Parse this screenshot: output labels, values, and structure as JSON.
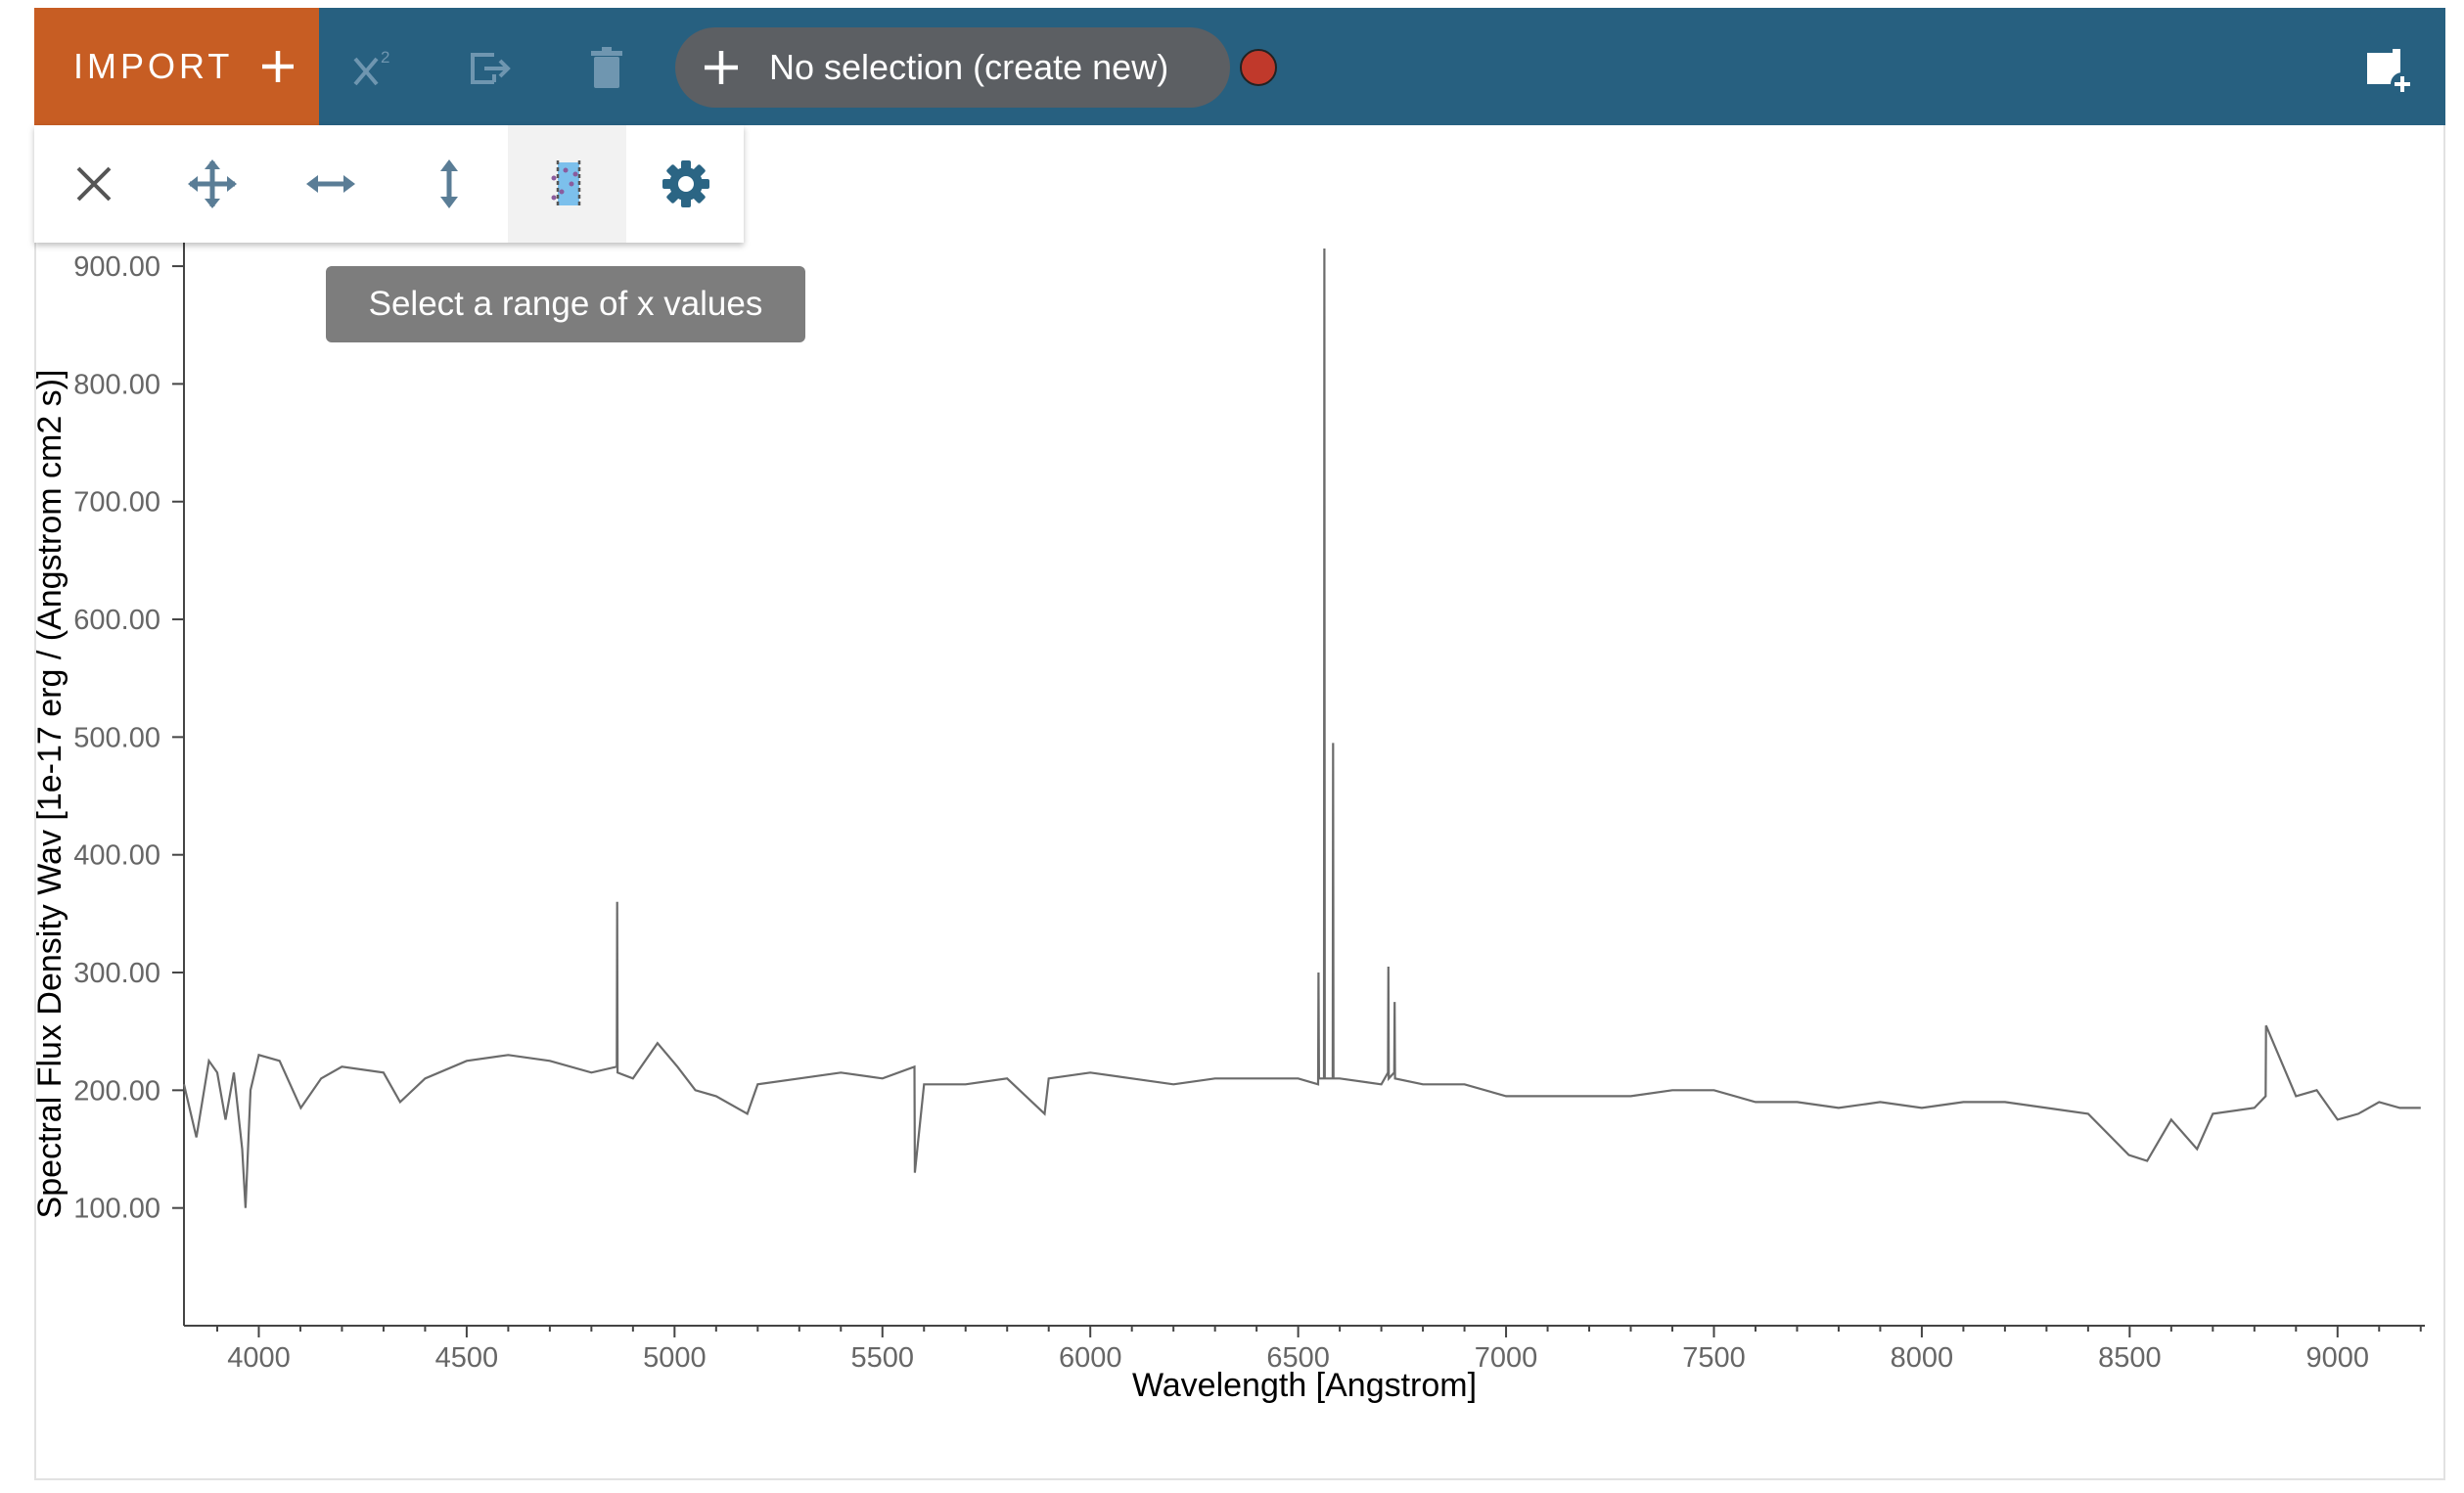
{
  "toolbar": {
    "import_label": "IMPORT",
    "selection_label": "No selection (create new)",
    "status_color": "#c0392b",
    "accent_color": "#276080",
    "import_color": "#c75d23",
    "icons": [
      "plus-icon",
      "chi-squared-icon",
      "export-icon",
      "trash-icon",
      "plus-icon",
      "status-dot",
      "new-viewer-icon"
    ]
  },
  "plot_toolbar": {
    "tools": [
      "close-icon",
      "pan-zoom-icon",
      "pan-x-icon",
      "pan-y-icon",
      "xrange-select-icon",
      "settings-icon"
    ],
    "active_tool": "xrange-select-icon"
  },
  "tooltip": {
    "text": "Select a range of x values"
  },
  "chart_data": {
    "type": "line",
    "xlabel": "Wavelength [Angstrom]",
    "ylabel": "Spectral Flux Density Wav [1e-17 erg / (Angstrom cm2 s)]",
    "xlim": [
      3820,
      9210
    ],
    "ylim": [
      0,
      920
    ],
    "xticks": [
      "4000",
      "4500",
      "5000",
      "5500",
      "6000",
      "6500",
      "7000",
      "7500",
      "8000",
      "8500",
      "9000"
    ],
    "yticks": [
      "100.00",
      "200.00",
      "300.00",
      "400.00",
      "500.00",
      "600.00",
      "700.00",
      "800.00",
      "900.00"
    ],
    "line_color": "#6b6b6b",
    "series": [
      {
        "x": [
          3820,
          3850,
          3880,
          3900,
          3920,
          3940,
          3960,
          3968,
          3980,
          4000,
          4050,
          4101,
          4150,
          4200,
          4300,
          4340,
          4400,
          4500,
          4600,
          4700,
          4800,
          4861,
          4862,
          4863,
          4900,
          4959,
          5007,
          5050,
          5100,
          5175,
          5200,
          5300,
          5400,
          5500,
          5577,
          5578,
          5600,
          5700,
          5800,
          5890,
          5900,
          6000,
          6100,
          6200,
          6300,
          6400,
          6500,
          6548,
          6549,
          6550,
          6562,
          6563,
          6564,
          6583,
          6584,
          6585,
          6600,
          6700,
          6716,
          6717,
          6718,
          6731,
          6732,
          6733,
          6800,
          6900,
          7000,
          7100,
          7200,
          7300,
          7400,
          7500,
          7600,
          7700,
          7800,
          7900,
          8000,
          8100,
          8200,
          8300,
          8400,
          8498,
          8542,
          8600,
          8662,
          8700,
          8800,
          8827,
          8828,
          8900,
          8950,
          9000,
          9050,
          9100,
          9150,
          9200
        ],
        "y": [
          205,
          160,
          225,
          215,
          175,
          215,
          150,
          100,
          200,
          230,
          225,
          185,
          210,
          220,
          215,
          190,
          210,
          225,
          230,
          225,
          215,
          220,
          360,
          215,
          210,
          240,
          220,
          200,
          195,
          180,
          205,
          210,
          215,
          210,
          220,
          130,
          205,
          205,
          210,
          180,
          210,
          215,
          210,
          205,
          210,
          210,
          210,
          205,
          300,
          210,
          210,
          915,
          210,
          210,
          495,
          210,
          210,
          205,
          215,
          305,
          210,
          215,
          275,
          210,
          205,
          205,
          195,
          195,
          195,
          195,
          200,
          200,
          190,
          190,
          185,
          190,
          185,
          190,
          190,
          185,
          180,
          145,
          140,
          175,
          150,
          180,
          185,
          195,
          255,
          195,
          200,
          175,
          180,
          190,
          185,
          185
        ]
      }
    ]
  }
}
